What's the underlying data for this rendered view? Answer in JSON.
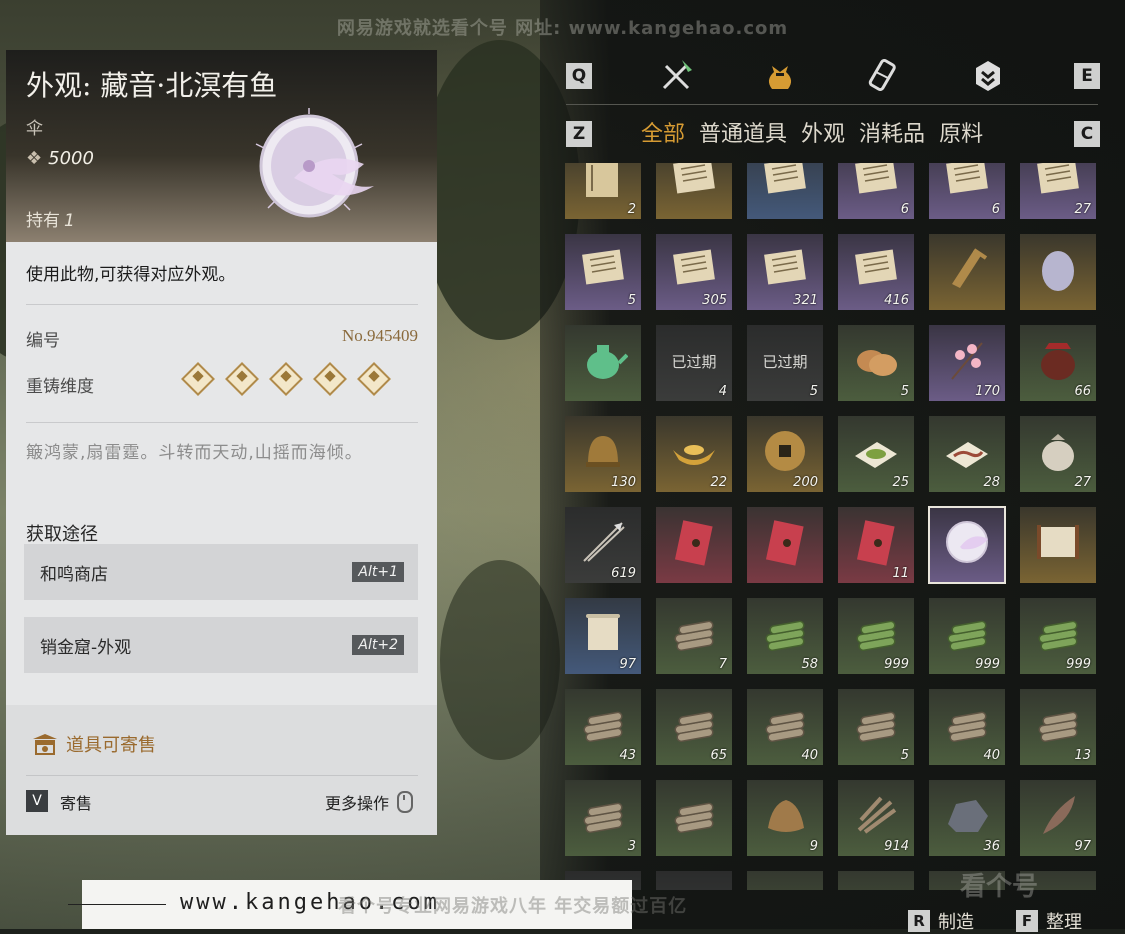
{
  "watermark_top": "网易游戏就选看个号  网址: www.kangehao.com",
  "watermark_bottom": {
    "url": "www.kangehao.com",
    "slogan": "看个号专业网易游戏八年  年交易额过百亿",
    "logo": "看个号"
  },
  "detail": {
    "title": "外观: 藏音·北溟有鱼",
    "type": "伞",
    "price": "5000",
    "own_label": "持有",
    "own_count": "1",
    "description": "使用此物,可获得对应外观。",
    "code_label": "编号",
    "code_value": "No.945409",
    "recast_label": "重铸维度",
    "recast_level": 5,
    "lore": "簸鸿蒙,扇雷霆。斗转而天动,山摇而海倾。",
    "source_title": "获取途径",
    "sources": [
      {
        "name": "和鸣商店",
        "key": "Alt+1"
      },
      {
        "name": "销金窟-外观",
        "key": "Alt+2"
      }
    ],
    "sellable_note": "道具可寄售",
    "sell_key": "V",
    "sell_label": "寄售",
    "more_ops": "更多操作"
  },
  "inventory": {
    "keys": {
      "prev_cat": "Q",
      "next_cat": "E",
      "prev_tab": "Z",
      "next_tab": "C"
    },
    "category_icons": [
      "swords-icon",
      "bag-icon",
      "scroll-icon",
      "badge-icon"
    ],
    "tabs": [
      "全部",
      "普通道具",
      "外观",
      "消耗品",
      "原料"
    ],
    "active_tab": 0,
    "rows": [
      [
        {
          "q": "2",
          "r": "gold",
          "i": "book-icon"
        },
        {
          "q": "",
          "r": "gold",
          "i": "letter-icon"
        },
        {
          "q": "",
          "r": "blue",
          "i": "letter-icon"
        },
        {
          "q": "6",
          "r": "purple",
          "i": "letter-icon"
        },
        {
          "q": "6",
          "r": "purple",
          "i": "letter-icon"
        },
        {
          "q": "27",
          "r": "purple",
          "i": "letter-icon"
        }
      ],
      [
        {
          "q": "5",
          "r": "purple",
          "i": "letter-icon"
        },
        {
          "q": "305",
          "r": "purple",
          "i": "letter-icon"
        },
        {
          "q": "321",
          "r": "purple",
          "i": "letter-icon"
        },
        {
          "q": "416",
          "r": "purple",
          "i": "letter-icon"
        },
        {
          "q": "",
          "r": "gold",
          "i": "ruler-icon"
        },
        {
          "q": "",
          "r": "gold",
          "i": "egg-icon"
        }
      ],
      [
        {
          "q": "",
          "r": "green",
          "i": "teapot-icon"
        },
        {
          "q": "4",
          "r": "gray",
          "i": "expired-icon",
          "exp": "已过期"
        },
        {
          "q": "5",
          "r": "gray",
          "i": "expired-icon",
          "exp": "已过期"
        },
        {
          "q": "5",
          "r": "green",
          "i": "bread-icon"
        },
        {
          "q": "170",
          "r": "purple",
          "i": "blossom-icon"
        },
        {
          "q": "66",
          "r": "green",
          "i": "jar-icon"
        }
      ],
      [
        {
          "q": "130",
          "r": "gold",
          "i": "helmet-icon"
        },
        {
          "q": "22",
          "r": "gold",
          "i": "ingot-icon"
        },
        {
          "q": "200",
          "r": "gold",
          "i": "coin-icon"
        },
        {
          "q": "25",
          "r": "green",
          "i": "powder-icon"
        },
        {
          "q": "28",
          "r": "green",
          "i": "worm-icon"
        },
        {
          "q": "27",
          "r": "green",
          "i": "pouch-icon"
        }
      ],
      [
        {
          "q": "619",
          "r": "gray",
          "i": "arrow-icon"
        },
        {
          "q": "",
          "r": "red",
          "i": "red-envelope-icon"
        },
        {
          "q": "",
          "r": "red",
          "i": "red-envelope-icon"
        },
        {
          "q": "11",
          "r": "red",
          "i": "red-envelope-icon"
        },
        {
          "q": "",
          "r": "purple",
          "i": "umbrella-icon",
          "sel": true
        },
        {
          "q": "",
          "r": "gold",
          "i": "painting-icon"
        }
      ],
      [
        {
          "q": "97",
          "r": "blue",
          "i": "scroll-icon"
        },
        {
          "q": "7",
          "r": "green",
          "i": "logs-icon"
        },
        {
          "q": "58",
          "r": "green",
          "i": "bamboo-icon"
        },
        {
          "q": "999",
          "r": "green",
          "i": "bamboo-icon"
        },
        {
          "q": "999",
          "r": "green",
          "i": "bamboo-icon"
        },
        {
          "q": "999",
          "r": "green",
          "i": "bamboo-icon"
        }
      ],
      [
        {
          "q": "43",
          "r": "green",
          "i": "logs-icon"
        },
        {
          "q": "65",
          "r": "green",
          "i": "logs-icon"
        },
        {
          "q": "40",
          "r": "green",
          "i": "logs-icon"
        },
        {
          "q": "5",
          "r": "green",
          "i": "logs-icon"
        },
        {
          "q": "40",
          "r": "green",
          "i": "logs-icon"
        },
        {
          "q": "13",
          "r": "green",
          "i": "logs-icon"
        }
      ],
      [
        {
          "q": "3",
          "r": "green",
          "i": "logs-icon"
        },
        {
          "q": "",
          "r": "green",
          "i": "logs-icon"
        },
        {
          "q": "9",
          "r": "green",
          "i": "fur-icon"
        },
        {
          "q": "914",
          "r": "green",
          "i": "branches-icon"
        },
        {
          "q": "36",
          "r": "green",
          "i": "ore-icon"
        },
        {
          "q": "97",
          "r": "green",
          "i": "feather-icon"
        }
      ],
      [
        {
          "q": "",
          "r": "gray",
          "i": "item-icon"
        },
        {
          "q": "",
          "r": "gray",
          "i": "item-icon"
        },
        {
          "q": "",
          "r": "green",
          "i": "item-icon"
        },
        {
          "q": "",
          "r": "green",
          "i": "item-icon"
        },
        {
          "q": "",
          "r": "green",
          "i": "item-icon"
        },
        {
          "q": "",
          "r": "green",
          "i": "item-icon"
        }
      ]
    ],
    "bottom_actions": [
      {
        "key": "R",
        "label": "制造"
      },
      {
        "key": "F",
        "label": "整理"
      }
    ]
  },
  "colors": {
    "accent_gold": "#d69b33",
    "brown_text": "#8a6a3c"
  }
}
